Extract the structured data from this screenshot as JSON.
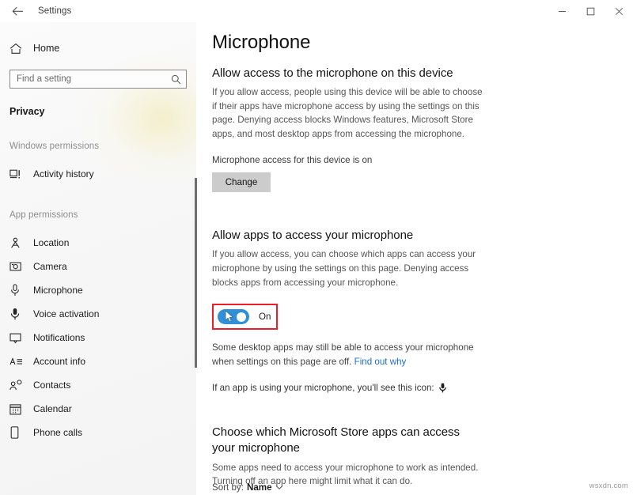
{
  "window": {
    "back_label": "back-arrow",
    "title": "Settings",
    "controls": {
      "minimize": "minimize",
      "maximize": "maximize",
      "close": "close"
    }
  },
  "sidebar": {
    "home_label": "Home",
    "home_icon": "home-icon",
    "search": {
      "placeholder": "Find a setting",
      "value": "",
      "icon": "search-icon"
    },
    "category": "Privacy",
    "groups": [
      {
        "label": "Windows permissions",
        "items": [
          {
            "label": "Activity history",
            "icon": "activity-history-icon",
            "selected": false
          }
        ]
      },
      {
        "label": "App permissions",
        "items": [
          {
            "label": "Location",
            "icon": "location-icon",
            "selected": false
          },
          {
            "label": "Camera",
            "icon": "camera-icon",
            "selected": false
          },
          {
            "label": "Microphone",
            "icon": "microphone-icon",
            "selected": true
          },
          {
            "label": "Voice activation",
            "icon": "voice-activation-icon",
            "selected": false
          },
          {
            "label": "Notifications",
            "icon": "notifications-icon",
            "selected": false
          },
          {
            "label": "Account info",
            "icon": "account-info-icon",
            "selected": false
          },
          {
            "label": "Contacts",
            "icon": "contacts-icon",
            "selected": false
          },
          {
            "label": "Calendar",
            "icon": "calendar-icon",
            "selected": false
          },
          {
            "label": "Phone calls",
            "icon": "phone-calls-icon",
            "selected": false
          }
        ]
      }
    ]
  },
  "main": {
    "page_title": "Microphone",
    "section_device": {
      "heading": "Allow access to the microphone on this device",
      "body": "If you allow access, people using this device will be able to choose if their apps have microphone access by using the settings on this page. Denying access blocks Windows features, Microsoft Store apps, and most desktop apps from accessing the microphone.",
      "status": "Microphone access for this device is on",
      "button_label": "Change"
    },
    "section_apps": {
      "heading": "Allow apps to access your microphone",
      "body": "If you allow access, you can choose which apps can access your microphone by using the settings on this page. Denying access blocks apps from accessing your microphone.",
      "toggle_state": "On",
      "toggle_on": true,
      "note_text": "Some desktop apps may still be able to access your microphone when settings on this page are off.",
      "note_link": "Find out why",
      "icon_note": "If an app is using your microphone, you'll see this icon:",
      "icon_note_icon": "microphone-icon"
    },
    "section_store": {
      "heading": "Choose which Microsoft Store apps can access your microphone",
      "body": "Some apps need to access your microphone to work as intended. Turning off an app here might limit what it can do.",
      "sort_label": "Sort by:",
      "sort_value": "Name",
      "sort_chevron": "chevron-down-icon"
    }
  },
  "annotation": {
    "highlight_color": "#ee1c25",
    "target": "allow-apps-microphone-toggle"
  },
  "colors": {
    "accent_blue": "#2f8fd8",
    "link_blue": "#1f71c1",
    "button_gray": "#cccccc",
    "sidebar_bg": "#f7f7f7"
  },
  "watermark": "wsxdn.com"
}
